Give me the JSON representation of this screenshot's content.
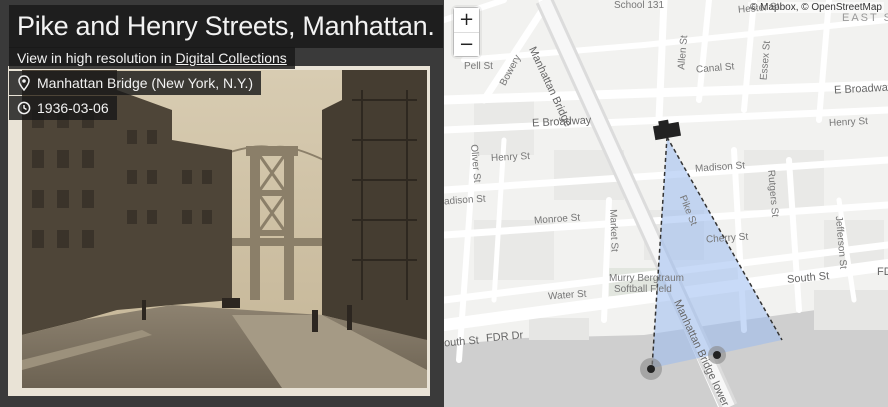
{
  "photo": {
    "title": "Pike and Henry Streets, Manhattan.",
    "hires_prefix": "View in high resolution in",
    "hires_link": "Digital Collections",
    "location": "Manhattan Bridge (New York, N.Y.)",
    "date": "1936-03-06",
    "location_icon": "map-pin-icon",
    "date_icon": "clock-icon"
  },
  "map": {
    "zoom_in": "+",
    "zoom_out": "−",
    "attribution": "© Mapbox, © OpenStreetMap",
    "labels": {
      "school": "School 131",
      "hester": "Hester St",
      "east": "EAST S",
      "manhattan_bridge": "Manhattan Bridge",
      "bowery": "Bowery",
      "allen": "Allen St",
      "canal": "Canal St",
      "essex": "Essex St",
      "pell": "Pell St",
      "e_broadway_top": "E Broadway",
      "e_broadway": "E Broadway",
      "henry_right": "Henry St",
      "henry_left": "Henry St",
      "oliver": "Oliver St",
      "madison_right": "Madison St",
      "madison_left": "adison St",
      "rutgers": "Rutgers St",
      "pike": "Pike St",
      "monroe": "Monroe St",
      "market": "Market St",
      "cherry": "Cherry St",
      "jefferson": "Jefferson St",
      "south_right": "South St",
      "fd": "FD",
      "murry": "Murry Bergtraum",
      "softball": "Softball Field",
      "water": "Water St",
      "south_left": "outh St",
      "fdr": "FDR Dr",
      "mb_lower": "Manhattan Bridge lower le"
    },
    "colors": {
      "water": "#cfcfcf",
      "view_cone": "#9bbcf0",
      "road": "#ffffff",
      "land": "#f2f2f0"
    }
  }
}
